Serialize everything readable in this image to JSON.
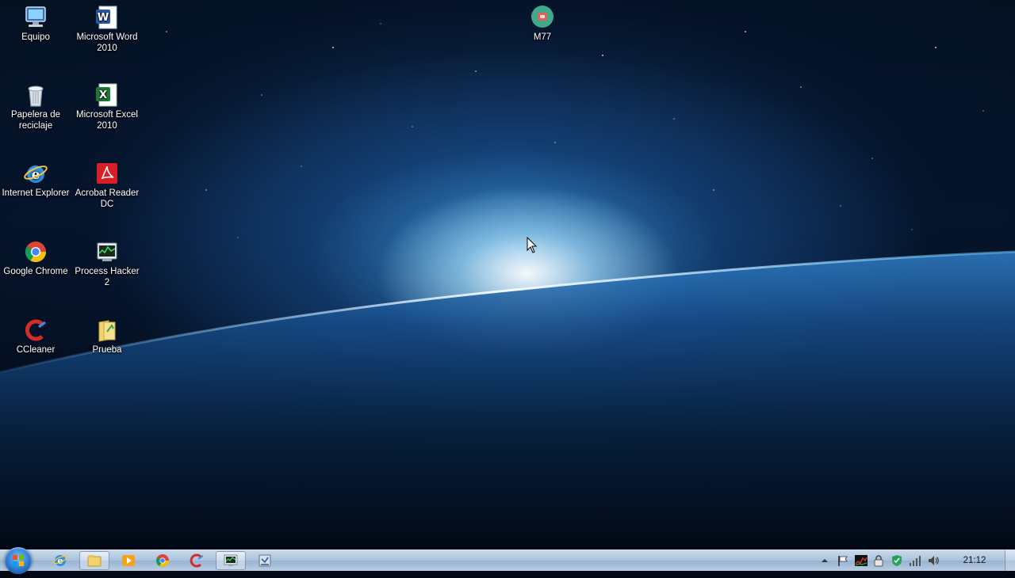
{
  "desktop_icons": [
    {
      "name": "computer-icon",
      "label": "Equipo"
    },
    {
      "name": "word-icon",
      "label": "Microsoft Word 2010"
    },
    {
      "name": "recycle-bin-icon",
      "label": "Papelera de reciclaje"
    },
    {
      "name": "excel-icon",
      "label": "Microsoft Excel 2010"
    },
    {
      "name": "internet-explorer-icon",
      "label": "Internet Explorer"
    },
    {
      "name": "acrobat-reader-icon",
      "label": "Acrobat Reader DC"
    },
    {
      "name": "chrome-icon",
      "label": "Google Chrome"
    },
    {
      "name": "process-hacker-icon",
      "label": "Process Hacker 2"
    },
    {
      "name": "ccleaner-icon",
      "label": "CCleaner"
    },
    {
      "name": "folder-icon",
      "label": "Prueba"
    },
    {
      "name": "m77-icon",
      "label": "M77"
    }
  ],
  "taskbar": {
    "start_icon": "windows-logo-icon",
    "pinned": [
      "internet-explorer-icon",
      "explorer-folder-icon",
      "media-player-icon",
      "chrome-icon",
      "ccleaner-icon",
      "process-hacker-icon",
      "network-tool-icon"
    ],
    "active_item": "process-hacker-icon",
    "tray_icons": [
      "show-hidden-icons-icon",
      "action-center-flag-icon",
      "cpu-graph-icon",
      "security-lock-icon",
      "antivirus-shield-icon",
      "network-signal-icon",
      "volume-icon"
    ],
    "clock": "21:12"
  },
  "colors": {
    "taskbar": "#b7cde3",
    "glow": "#78c8ff",
    "space": "#04101f"
  }
}
